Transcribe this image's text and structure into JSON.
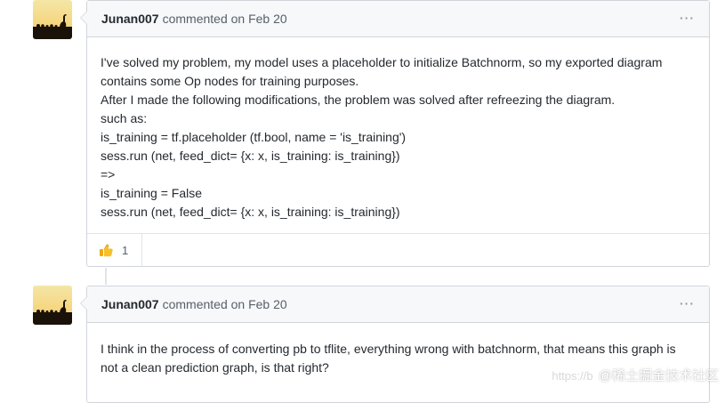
{
  "comments": [
    {
      "author": "Junan007",
      "meta": "commented on Feb 20",
      "menu": "···",
      "body": [
        "I've solved my problem, my model uses a placeholder to initialize Batchnorm, so my exported diagram",
        "contains some Op nodes for training purposes.",
        "After I made the following modifications, the problem was solved after refreezing the diagram.",
        "such as:",
        "is_training = tf.placeholder (tf.bool, name = 'is_training')",
        "sess.run (net, feed_dict= {x: x, is_training: is_training})",
        "=>",
        "is_training = False",
        "sess.run (net, feed_dict= {x: x, is_training: is_training})"
      ],
      "reaction": {
        "icon": "thumbs-up-icon",
        "count": "1"
      }
    },
    {
      "author": "Junan007",
      "meta": "commented on Feb 20",
      "menu": "···",
      "body": [
        "I think in the process of converting pb to tflite, everything wrong with batchnorm, that means this graph is",
        "not a clean prediction graph, is that right?"
      ]
    }
  ],
  "watermark": {
    "url": "https://b",
    "text": "@稀土掘金技术社区"
  }
}
